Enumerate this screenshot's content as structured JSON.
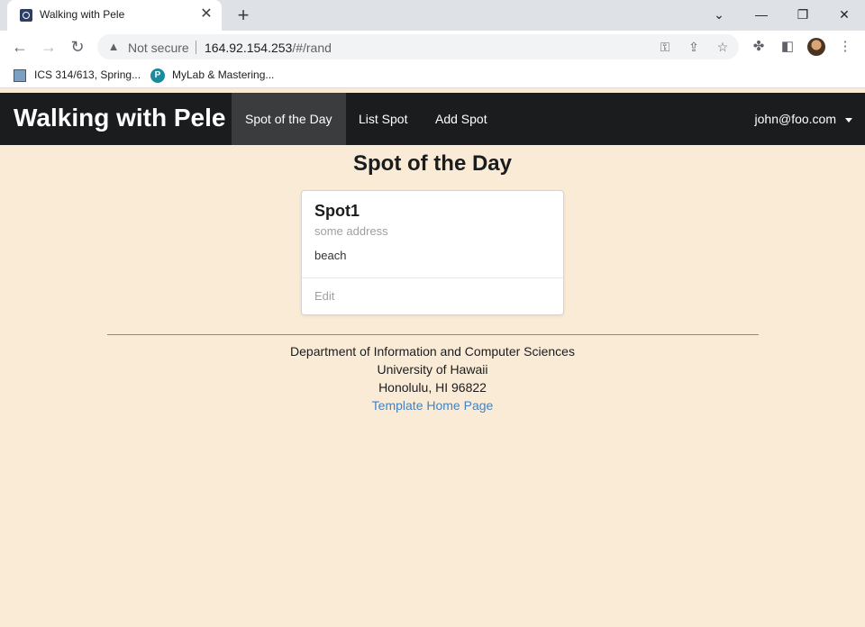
{
  "browser": {
    "tab_title": "Walking with Pele",
    "security_label": "Not secure",
    "url_host": "164.92.154.253",
    "url_path": "/#/rand",
    "bookmarks": [
      "ICS 314/613, Spring...",
      "MyLab & Mastering..."
    ],
    "bookmark_icon_letter": "P"
  },
  "navbar": {
    "brand": "Walking with Pele",
    "items": [
      {
        "label": "Spot of the Day",
        "active": true
      },
      {
        "label": "List Spot",
        "active": false
      },
      {
        "label": "Add Spot",
        "active": false
      }
    ],
    "user": "john@foo.com"
  },
  "main": {
    "title": "Spot of the Day",
    "card": {
      "name": "Spot1",
      "address": "some address",
      "description": "beach",
      "edit_label": "Edit"
    }
  },
  "footer": {
    "line1": "Department of Information and Computer Sciences",
    "line2": "University of Hawaii",
    "line3": "Honolulu, HI 96822",
    "link": "Template Home Page"
  },
  "colors": {
    "page_bg": "#faebd7",
    "navbar_bg": "#1b1c1d",
    "active_nav_bg": "#3b3c3d",
    "link": "#4183c4"
  }
}
